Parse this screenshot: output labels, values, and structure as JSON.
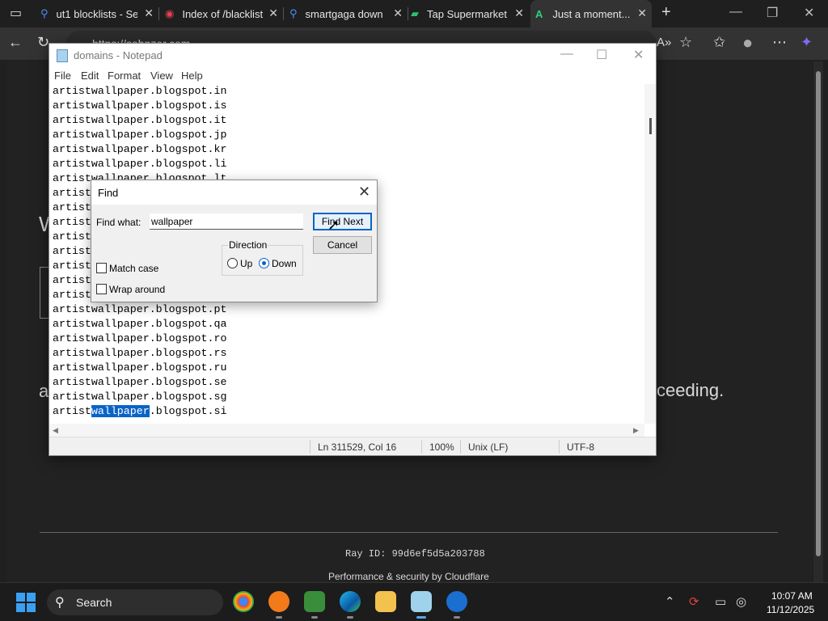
{
  "browser": {
    "tabs": [
      {
        "title": "ut1 blocklists - Se",
        "active": false
      },
      {
        "title": "Index of /blacklist",
        "active": false
      },
      {
        "title": "smartgaga down",
        "active": false
      },
      {
        "title": "Tap Supermarket",
        "active": false
      },
      {
        "title": "Just a moment...",
        "active": true
      }
    ],
    "new_tab": "+",
    "close_glyph": "✕",
    "address": "https://sabnzer.com"
  },
  "page": {
    "left_fragment": "a",
    "right_fragment": "ceeding.",
    "heading_fragment": "W",
    "ray_id": "Ray ID: 99d6ef5d5a203788",
    "footer": "Performance & security by Cloudflare"
  },
  "notepad": {
    "title": "domains - Notepad",
    "menu": [
      "File",
      "Edit",
      "Format",
      "View",
      "Help"
    ],
    "lines": [
      "artistwallpaper.blogspot.in",
      "artistwallpaper.blogspot.is",
      "artistwallpaper.blogspot.it",
      "artistwallpaper.blogspot.jp",
      "artistwallpaper.blogspot.kr",
      "artistwallpaper.blogspot.li",
      "artistwallpaper.blogspot.lt",
      "artist",
      "artist",
      "artist",
      "artist",
      "artist",
      "artist",
      "artist",
      "artist",
      "artistwallpaper.blogspot.pt",
      "artistwallpaper.blogspot.qa",
      "artistwallpaper.blogspot.ro",
      "artistwallpaper.blogspot.rs",
      "artistwallpaper.blogspot.ru",
      "artistwallpaper.blogspot.se",
      "artistwallpaper.blogspot.sg"
    ],
    "highlight_line": {
      "before": "artist",
      "match": "wallpaper",
      "after": ".blogspot.si"
    },
    "status": {
      "position": "Ln 311529, Col 16",
      "zoom": "100%",
      "line_ending": "Unix (LF)",
      "encoding": "UTF-8"
    }
  },
  "find_dialog": {
    "title": "Find",
    "find_what_label": "Find what:",
    "find_what_value": "wallpaper",
    "find_next_label": "Find Next",
    "cancel_label": "Cancel",
    "direction_label": "Direction",
    "up_label": "Up",
    "down_label": "Down",
    "match_case_label": "Match case",
    "wrap_around_label": "Wrap around",
    "direction_selected": "Down",
    "match_case": false,
    "wrap_around": false
  },
  "taskbar": {
    "search_label": "Search",
    "time": "10:07 AM",
    "date": "11/12/2025"
  },
  "colors": {
    "selection": "#0a64c8",
    "windows_blue": "#3aa0f2"
  }
}
